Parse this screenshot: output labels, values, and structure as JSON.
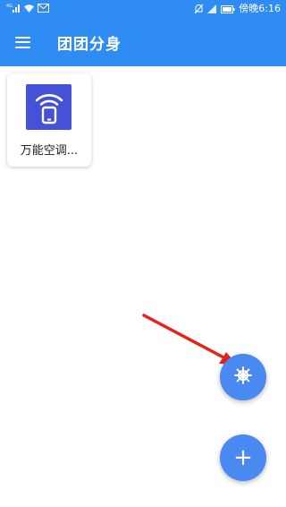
{
  "status_bar": {
    "network": "4G",
    "time": "傍晚6:16"
  },
  "app_bar": {
    "title": "团团分身"
  },
  "apps": [
    {
      "label": "万能空调...",
      "icon": "wifi-phone-icon"
    }
  ],
  "fabs": {
    "wheel_icon": "ship-wheel-icon",
    "add_label": "+"
  },
  "colors": {
    "primary": "#2f8cf2",
    "fab": "#4a89f0",
    "app_icon_bg": "#4552d8",
    "annotation_arrow": "#e8231b"
  }
}
